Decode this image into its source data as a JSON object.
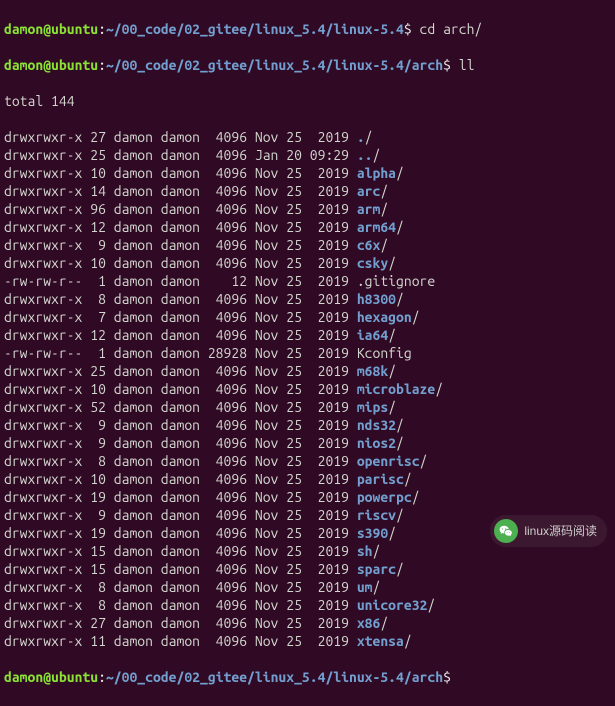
{
  "prompt": {
    "user": "damon",
    "host": "ubuntu",
    "path": "~/00_code/02_gitee/linux_5.4/linux-5.4/arch",
    "symbol": "$",
    "command": "ll"
  },
  "top_cutoff_command": "cd arch/",
  "total_line": "total 144",
  "rows": [
    {
      "perm": "drwxrwxr-x",
      "links": "27",
      "owner": "damon",
      "group": "damon",
      "size": "4096",
      "date": "Nov 25  2019",
      "name": "./",
      "dir": true
    },
    {
      "perm": "drwxrwxr-x",
      "links": "25",
      "owner": "damon",
      "group": "damon",
      "size": "4096",
      "date": "Jan 20 09:29",
      "name": "../",
      "dir": true
    },
    {
      "perm": "drwxrwxr-x",
      "links": "10",
      "owner": "damon",
      "group": "damon",
      "size": "4096",
      "date": "Nov 25  2019",
      "name": "alpha/",
      "dir": true
    },
    {
      "perm": "drwxrwxr-x",
      "links": "14",
      "owner": "damon",
      "group": "damon",
      "size": "4096",
      "date": "Nov 25  2019",
      "name": "arc/",
      "dir": true
    },
    {
      "perm": "drwxrwxr-x",
      "links": "96",
      "owner": "damon",
      "group": "damon",
      "size": "4096",
      "date": "Nov 25  2019",
      "name": "arm/",
      "dir": true
    },
    {
      "perm": "drwxrwxr-x",
      "links": "12",
      "owner": "damon",
      "group": "damon",
      "size": "4096",
      "date": "Nov 25  2019",
      "name": "arm64/",
      "dir": true
    },
    {
      "perm": "drwxrwxr-x",
      "links": "9",
      "owner": "damon",
      "group": "damon",
      "size": "4096",
      "date": "Nov 25  2019",
      "name": "c6x/",
      "dir": true
    },
    {
      "perm": "drwxrwxr-x",
      "links": "10",
      "owner": "damon",
      "group": "damon",
      "size": "4096",
      "date": "Nov 25  2019",
      "name": "csky/",
      "dir": true
    },
    {
      "perm": "-rw-rw-r--",
      "links": "1",
      "owner": "damon",
      "group": "damon",
      "size": "12",
      "date": "Nov 25  2019",
      "name": ".gitignore",
      "dir": false
    },
    {
      "perm": "drwxrwxr-x",
      "links": "8",
      "owner": "damon",
      "group": "damon",
      "size": "4096",
      "date": "Nov 25  2019",
      "name": "h8300/",
      "dir": true
    },
    {
      "perm": "drwxrwxr-x",
      "links": "7",
      "owner": "damon",
      "group": "damon",
      "size": "4096",
      "date": "Nov 25  2019",
      "name": "hexagon/",
      "dir": true
    },
    {
      "perm": "drwxrwxr-x",
      "links": "12",
      "owner": "damon",
      "group": "damon",
      "size": "4096",
      "date": "Nov 25  2019",
      "name": "ia64/",
      "dir": true
    },
    {
      "perm": "-rw-rw-r--",
      "links": "1",
      "owner": "damon",
      "group": "damon",
      "size": "28928",
      "date": "Nov 25  2019",
      "name": "Kconfig",
      "dir": false
    },
    {
      "perm": "drwxrwxr-x",
      "links": "25",
      "owner": "damon",
      "group": "damon",
      "size": "4096",
      "date": "Nov 25  2019",
      "name": "m68k/",
      "dir": true
    },
    {
      "perm": "drwxrwxr-x",
      "links": "10",
      "owner": "damon",
      "group": "damon",
      "size": "4096",
      "date": "Nov 25  2019",
      "name": "microblaze/",
      "dir": true
    },
    {
      "perm": "drwxrwxr-x",
      "links": "52",
      "owner": "damon",
      "group": "damon",
      "size": "4096",
      "date": "Nov 25  2019",
      "name": "mips/",
      "dir": true
    },
    {
      "perm": "drwxrwxr-x",
      "links": "9",
      "owner": "damon",
      "group": "damon",
      "size": "4096",
      "date": "Nov 25  2019",
      "name": "nds32/",
      "dir": true
    },
    {
      "perm": "drwxrwxr-x",
      "links": "9",
      "owner": "damon",
      "group": "damon",
      "size": "4096",
      "date": "Nov 25  2019",
      "name": "nios2/",
      "dir": true
    },
    {
      "perm": "drwxrwxr-x",
      "links": "8",
      "owner": "damon",
      "group": "damon",
      "size": "4096",
      "date": "Nov 25  2019",
      "name": "openrisc/",
      "dir": true
    },
    {
      "perm": "drwxrwxr-x",
      "links": "10",
      "owner": "damon",
      "group": "damon",
      "size": "4096",
      "date": "Nov 25  2019",
      "name": "parisc/",
      "dir": true
    },
    {
      "perm": "drwxrwxr-x",
      "links": "19",
      "owner": "damon",
      "group": "damon",
      "size": "4096",
      "date": "Nov 25  2019",
      "name": "powerpc/",
      "dir": true
    },
    {
      "perm": "drwxrwxr-x",
      "links": "9",
      "owner": "damon",
      "group": "damon",
      "size": "4096",
      "date": "Nov 25  2019",
      "name": "riscv/",
      "dir": true
    },
    {
      "perm": "drwxrwxr-x",
      "links": "19",
      "owner": "damon",
      "group": "damon",
      "size": "4096",
      "date": "Nov 25  2019",
      "name": "s390/",
      "dir": true
    },
    {
      "perm": "drwxrwxr-x",
      "links": "15",
      "owner": "damon",
      "group": "damon",
      "size": "4096",
      "date": "Nov 25  2019",
      "name": "sh/",
      "dir": true
    },
    {
      "perm": "drwxrwxr-x",
      "links": "15",
      "owner": "damon",
      "group": "damon",
      "size": "4096",
      "date": "Nov 25  2019",
      "name": "sparc/",
      "dir": true
    },
    {
      "perm": "drwxrwxr-x",
      "links": "8",
      "owner": "damon",
      "group": "damon",
      "size": "4096",
      "date": "Nov 25  2019",
      "name": "um/",
      "dir": true
    },
    {
      "perm": "drwxrwxr-x",
      "links": "8",
      "owner": "damon",
      "group": "damon",
      "size": "4096",
      "date": "Nov 25  2019",
      "name": "unicore32/",
      "dir": true
    },
    {
      "perm": "drwxrwxr-x",
      "links": "27",
      "owner": "damon",
      "group": "damon",
      "size": "4096",
      "date": "Nov 25  2019",
      "name": "x86/",
      "dir": true
    },
    {
      "perm": "drwxrwxr-x",
      "links": "11",
      "owner": "damon",
      "group": "damon",
      "size": "4096",
      "date": "Nov 25  2019",
      "name": "xtensa/",
      "dir": true
    }
  ],
  "watermark": "linux源码阅读"
}
